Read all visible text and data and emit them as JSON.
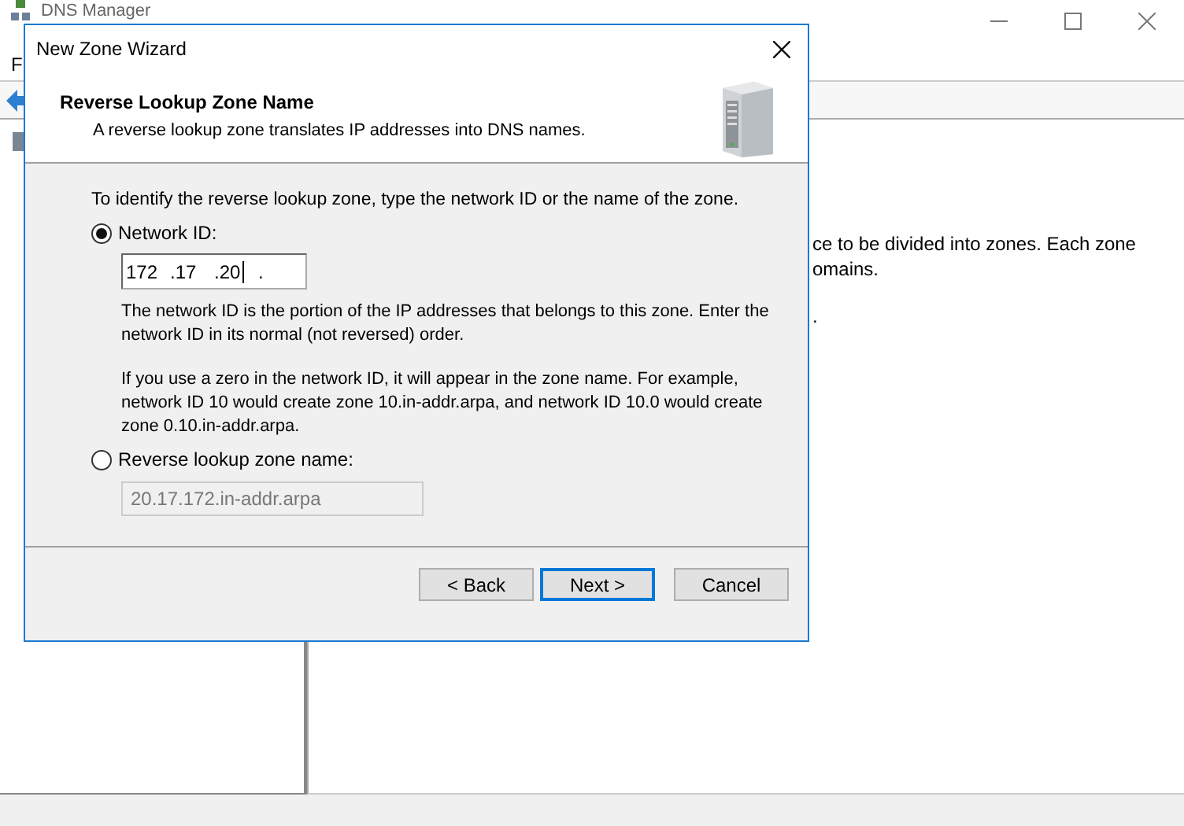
{
  "app": {
    "title": "DNS Manager",
    "menu": [
      "F"
    ],
    "right_pane_lines": [
      "ce to be divided into zones. Each zone",
      "omains.",
      "."
    ]
  },
  "dialog": {
    "title": "New Zone Wizard",
    "header": {
      "title": "Reverse Lookup Zone Name",
      "subtitle": "A reverse lookup zone translates IP addresses into DNS names."
    },
    "instruction": "To identify the reverse lookup zone, type the network ID or the name of the zone.",
    "options": [
      {
        "kind": "network_id",
        "label": "Network ID:",
        "selected": true,
        "segments": [
          "172",
          ".17",
          ".20",
          "."
        ],
        "focused": true,
        "help": [
          "The network ID is the portion of the IP addresses that belongs to this zone. Enter the network ID in its normal (not reversed) order.",
          "If you use a zero in the network ID, it will appear in the zone name. For example, network ID 10 would create zone 10.in-addr.arpa, and network ID 10.0 would create zone 0.10.in-addr.arpa."
        ]
      },
      {
        "kind": "zone_name",
        "label": "Reverse lookup zone name:",
        "selected": false,
        "value": "20.17.172.in-addr.arpa",
        "disabled": true
      }
    ],
    "buttons": [
      {
        "label": "< Back",
        "default": false
      },
      {
        "label": "Next >",
        "default": true
      },
      {
        "label": "Cancel",
        "default": false
      }
    ]
  }
}
